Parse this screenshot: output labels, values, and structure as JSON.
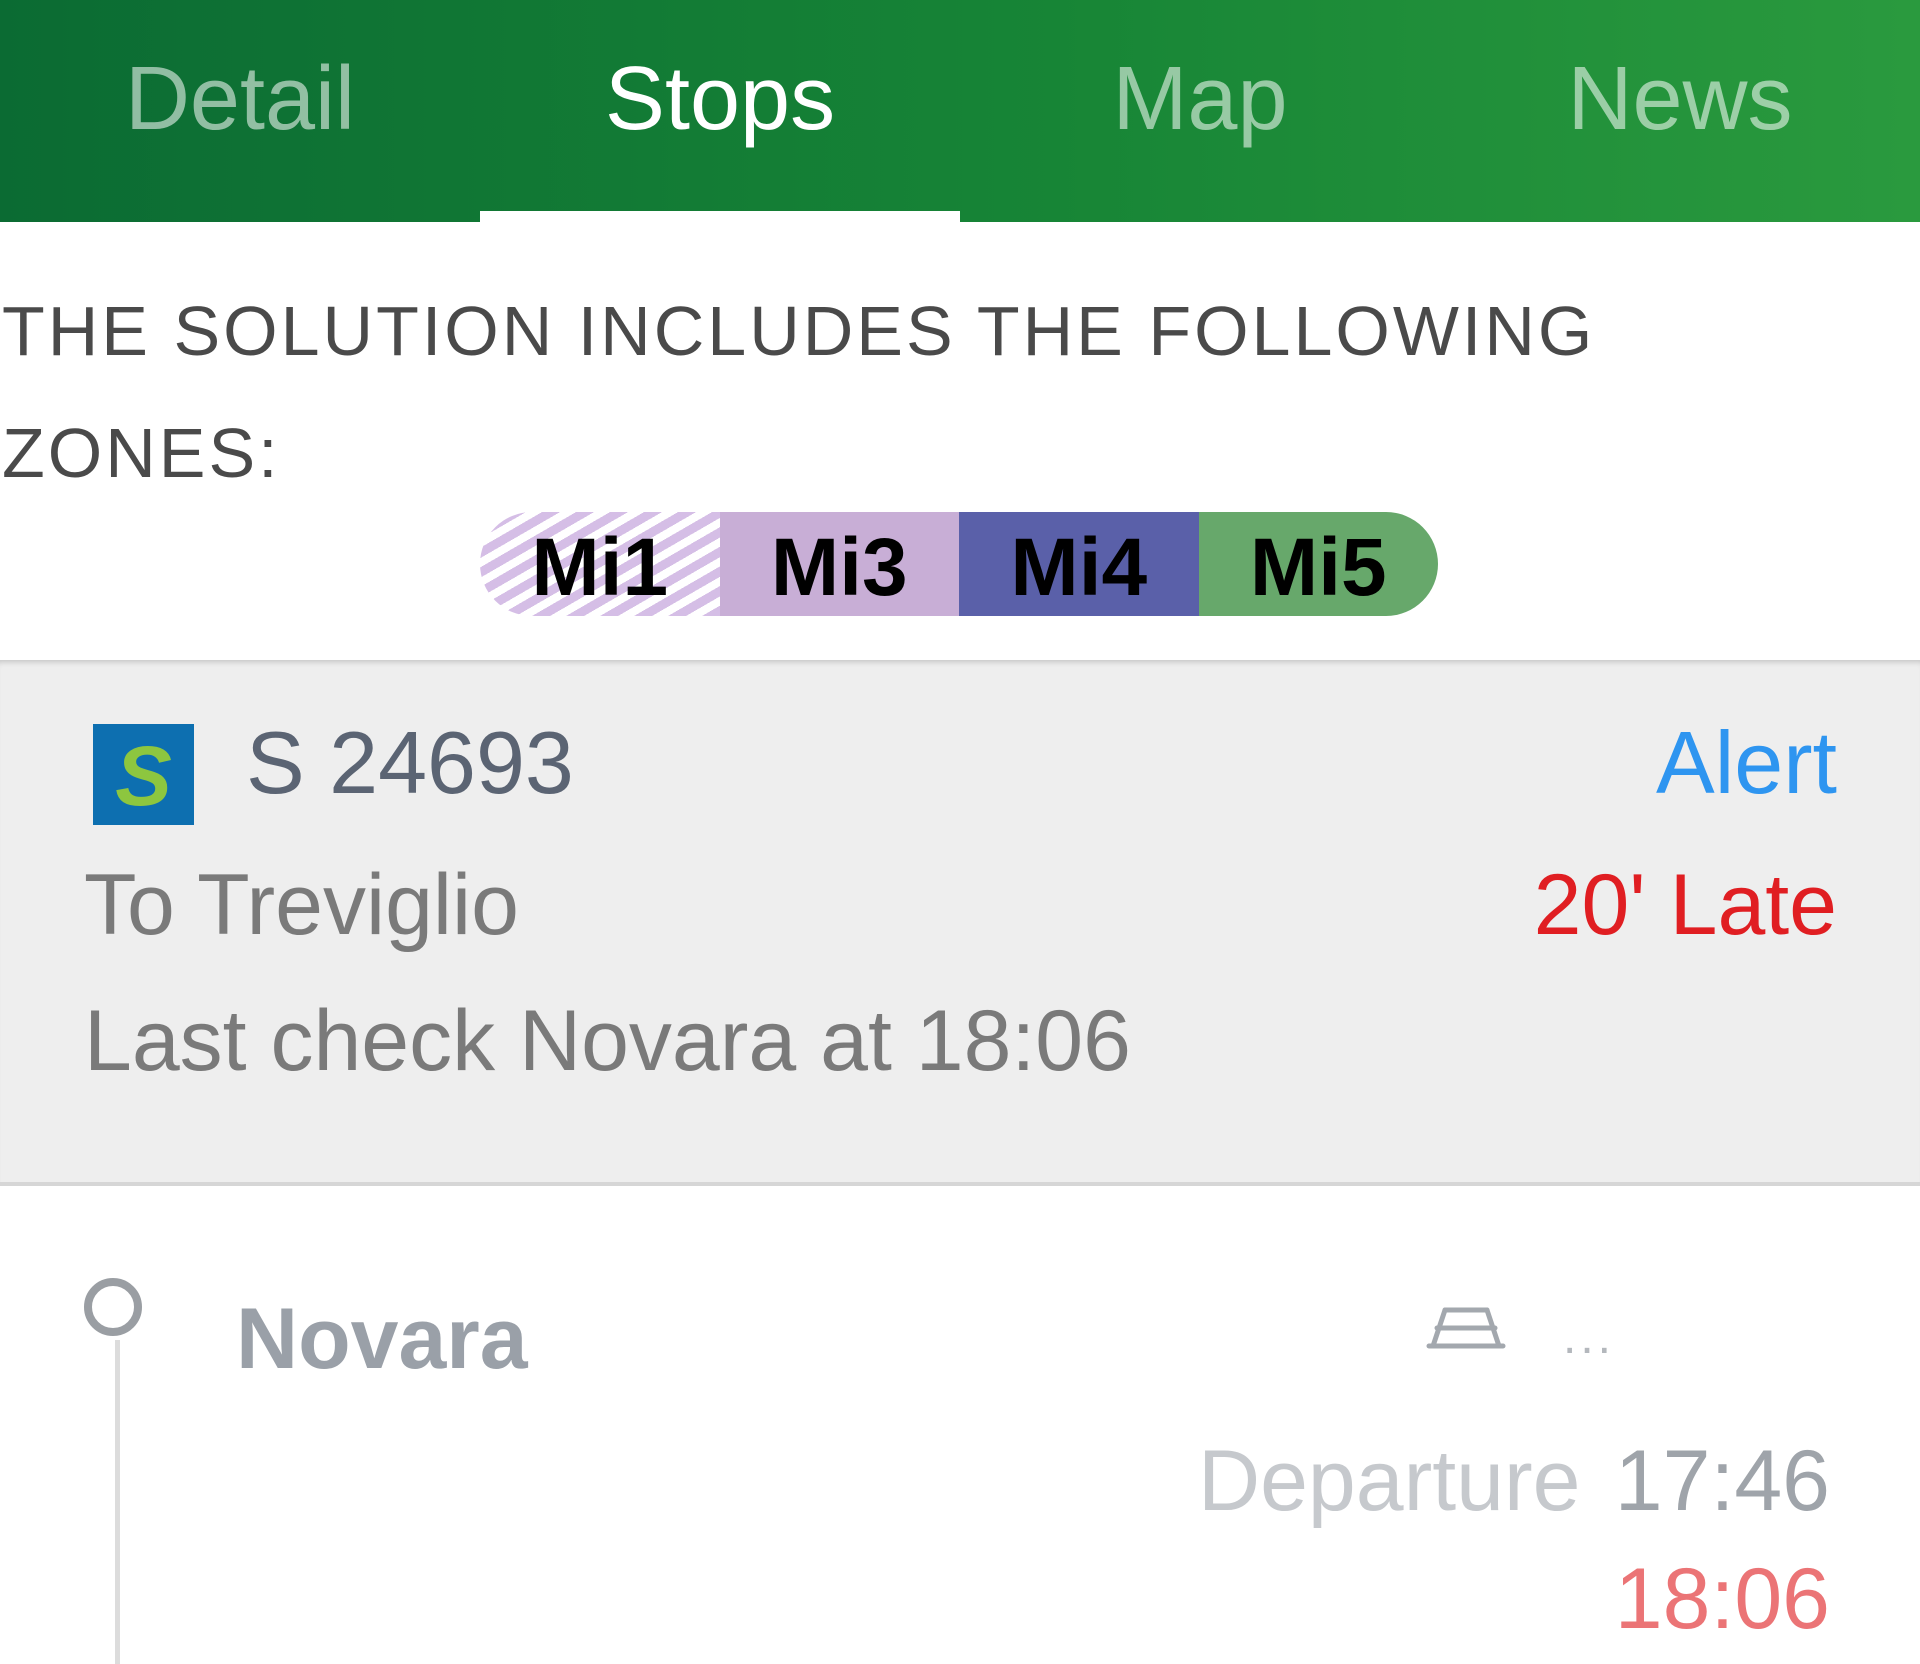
{
  "tabs": [
    {
      "label": "Detail",
      "active": false
    },
    {
      "label": "Stops",
      "active": true
    },
    {
      "label": "Map",
      "active": false
    },
    {
      "label": "News",
      "active": false
    }
  ],
  "zones": {
    "title": "THE SOLUTION INCLUDES THE FOLLOWING ZONES:",
    "items": [
      {
        "label": "Mi1",
        "color": "#d5bee6",
        "pattern": "hatched"
      },
      {
        "label": "Mi3",
        "color": "#c8aed6"
      },
      {
        "label": "Mi4",
        "color": "#5a60a9"
      },
      {
        "label": "Mi5",
        "color": "#67a86b"
      }
    ]
  },
  "train": {
    "logo": "suburban-s-icon",
    "logo_letter": "S",
    "logo_colors": {
      "background": "#0d6fb0",
      "letter": "#8dc63f"
    },
    "number": "S 24693",
    "alert_label": "Alert",
    "destination": "To Treviglio",
    "delay": "20' Late",
    "last_check": "Last check Novara at 18:06"
  },
  "stops": [
    {
      "name": "Novara",
      "platform_icon": "track-icon",
      "platform": "...",
      "departure_label": "Departure",
      "scheduled": "17:46",
      "actual": "18:06"
    }
  ],
  "colors": {
    "tab_bar_start": "#0b6b33",
    "tab_bar_end": "#2a9a3e",
    "alert": "#2e95f0",
    "delay": "#e01e22",
    "actual_time": "#eb7476"
  }
}
